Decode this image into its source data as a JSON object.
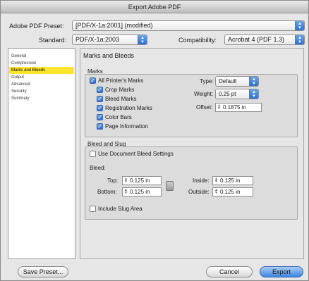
{
  "window": {
    "title": "Export Adobe PDF"
  },
  "top": {
    "preset_label": "Adobe PDF Preset:",
    "preset_value": "[PDF/X-1a:2001] (modified)",
    "standard_label": "Standard:",
    "standard_value": "PDF/X-1a:2003",
    "compat_label": "Compatibility:",
    "compat_value": "Acrobat 4 (PDF 1.3)"
  },
  "sidebar": {
    "items": [
      {
        "label": "General",
        "selected": false
      },
      {
        "label": "Compression",
        "selected": false
      },
      {
        "label": "Marks and Bleeds",
        "selected": true
      },
      {
        "label": "Output",
        "selected": false
      },
      {
        "label": "Advanced",
        "selected": false
      },
      {
        "label": "Security",
        "selected": false
      },
      {
        "label": "Summary",
        "selected": false
      }
    ]
  },
  "panel": {
    "title": "Marks and Bleeds",
    "marks": {
      "label": "Marks",
      "all_printers": "All Printer's Marks",
      "crop": "Crop Marks",
      "bleed": "Bleed Marks",
      "registration": "Registration Marks",
      "color_bars": "Color Bars",
      "page_info": "Page Information",
      "type_label": "Type:",
      "type_value": "Default",
      "weight_label": "Weight:",
      "weight_value": "0.25 pt",
      "offset_label": "Offset:",
      "offset_value": "0.1875 in"
    },
    "bleed_slug": {
      "label": "Bleed and Slug",
      "use_doc": "Use Document Bleed Settings",
      "bleed_label": "Bleed:",
      "top_label": "Top:",
      "top_value": "0.125 in",
      "bottom_label": "Bottom:",
      "bottom_value": "0.125 in",
      "inside_label": "Inside:",
      "inside_value": "0.125 in",
      "outside_label": "Outside:",
      "outside_value": "0.125 in",
      "include_slug": "Include Slug Area"
    }
  },
  "footer": {
    "save_preset": "Save Preset...",
    "cancel": "Cancel",
    "export": "Export"
  },
  "colors": {
    "selection": "#ffe52e",
    "accent_blue": "#3d86e0"
  }
}
